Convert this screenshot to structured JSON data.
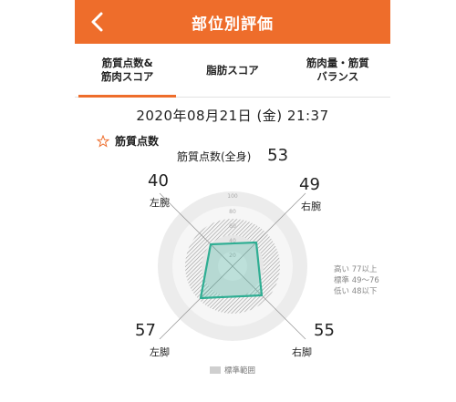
{
  "header": {
    "title": "部位別評価",
    "accent_color": "#ee6d2b"
  },
  "tabs": [
    {
      "line1": "筋質点数&",
      "line2": "筋肉スコア",
      "active": true
    },
    {
      "line1": "脂肪スコア",
      "line2": "",
      "active": false
    },
    {
      "line1": "筋肉量・筋質",
      "line2": "バランス",
      "active": false
    }
  ],
  "datetime": "2020年08月21日 (金) 21:37",
  "section": {
    "title": "筋質点数",
    "icon": "star-outline-icon"
  },
  "whole_body": {
    "label": "筋質点数(全身)",
    "value": "53"
  },
  "radar": {
    "left_arm": {
      "label": "左腕",
      "value": "40"
    },
    "right_arm": {
      "label": "右腕",
      "value": "49"
    },
    "left_leg": {
      "label": "左脚",
      "value": "57"
    },
    "right_leg": {
      "label": "右脚",
      "value": "55"
    },
    "scale_labels": [
      "100",
      "80",
      "60",
      "40",
      "20"
    ],
    "fill_color": "#3bb7a0"
  },
  "legend": {
    "high": "高い 77以上",
    "standard": "標準 49〜76",
    "low": "低い 48以下",
    "standard_range": "標準範囲"
  }
}
